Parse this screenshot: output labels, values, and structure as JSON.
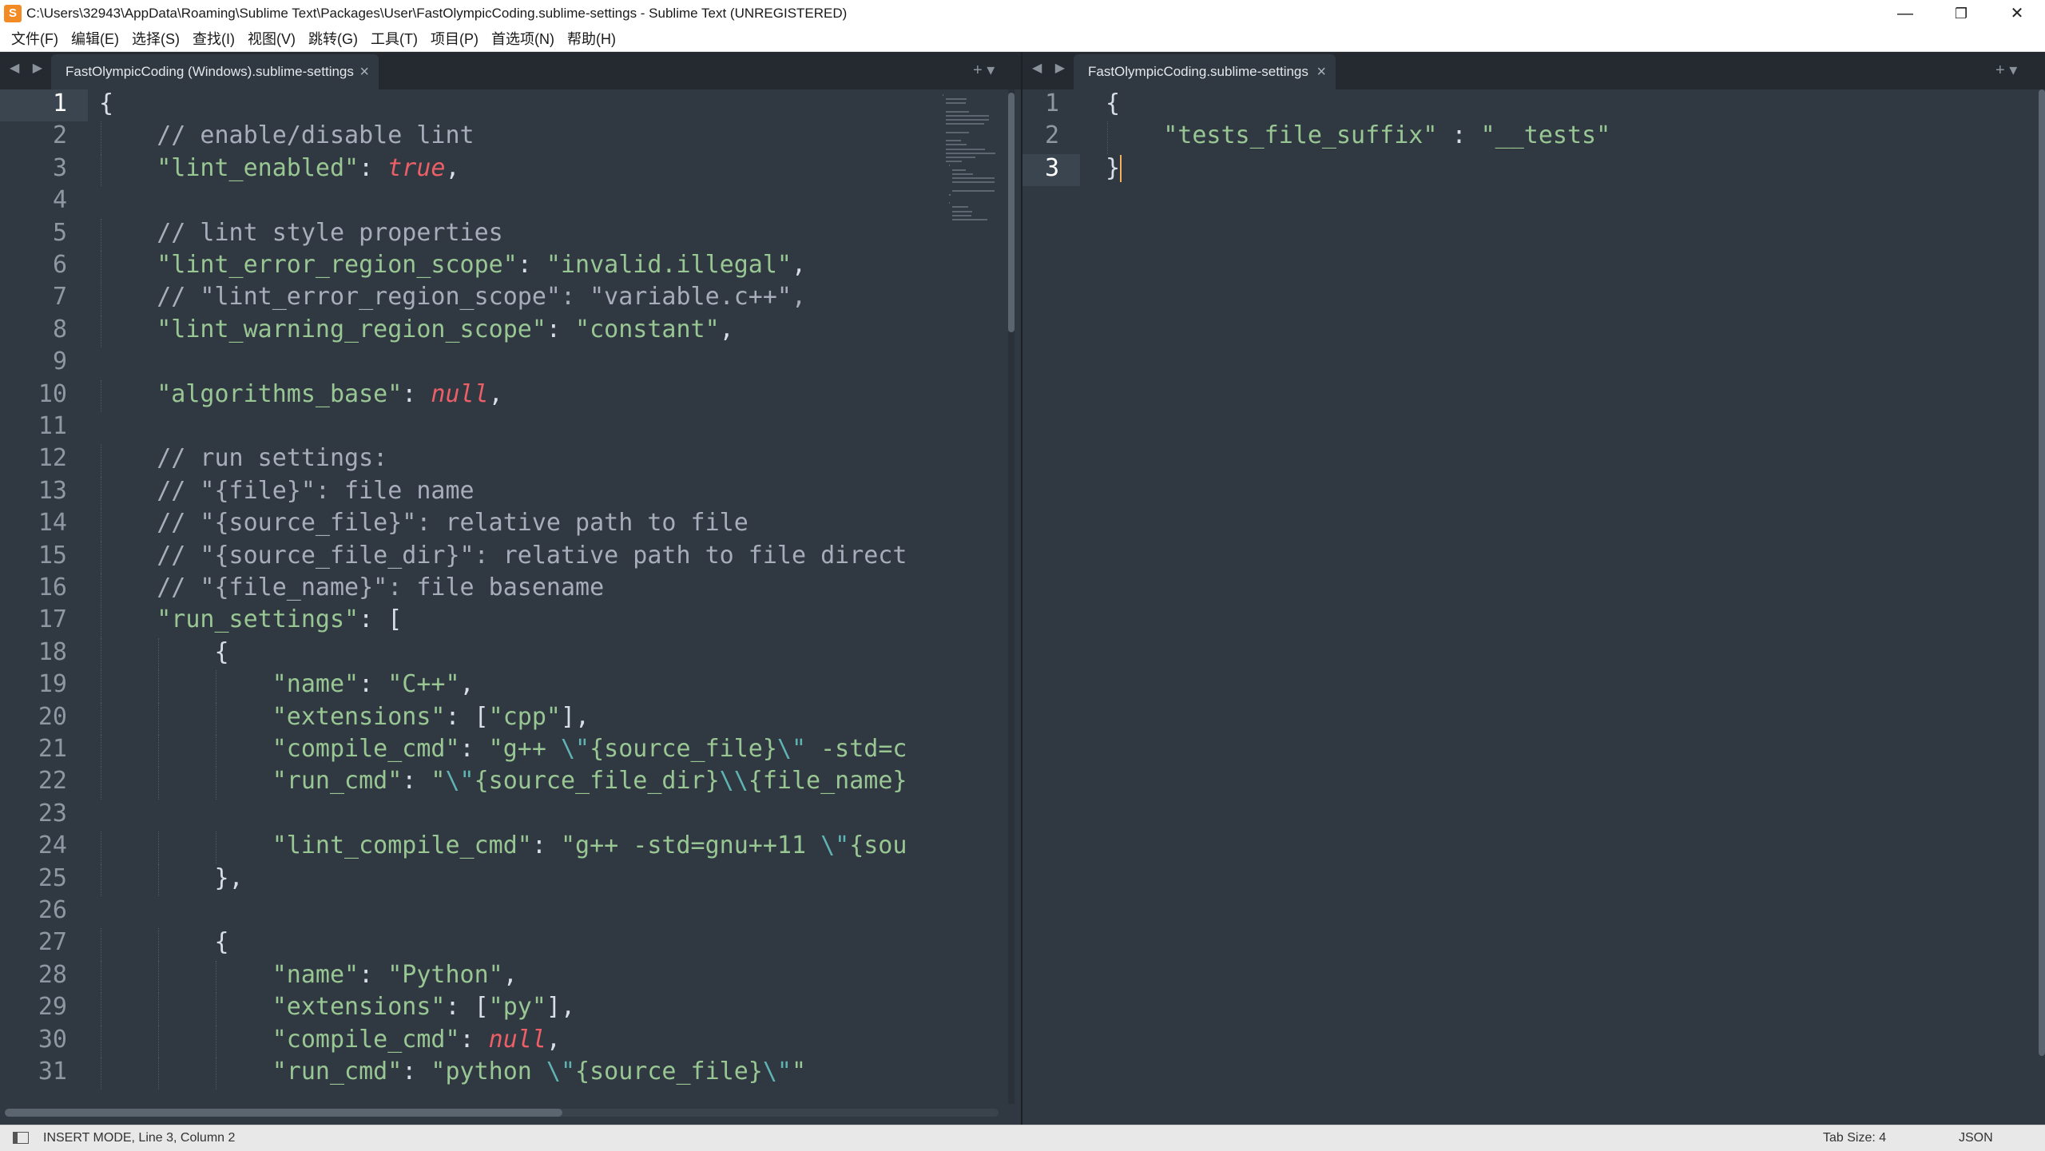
{
  "window": {
    "title": "C:\\Users\\32943\\AppData\\Roaming\\Sublime Text\\Packages\\User\\FastOlympicCoding.sublime-settings - Sublime Text (UNREGISTERED)",
    "logo_glyph": "S",
    "controls": {
      "minimize": "—",
      "restore": "❐",
      "close": "✕"
    }
  },
  "menu": [
    "文件(F)",
    "编辑(E)",
    "选择(S)",
    "查找(I)",
    "视图(V)",
    "跳转(G)",
    "工具(T)",
    "项目(P)",
    "首选项(N)",
    "帮助(H)"
  ],
  "left_pane": {
    "tab_nav": "◀ ▶",
    "tab_label": "FastOlympicCoding (Windows).sublime-settings",
    "tab_close": "×",
    "tab_tools": "+ ▾",
    "active_line": 1,
    "lines": [
      {
        "n": "1",
        "indent": 0,
        "tokens": [
          {
            "t": "{",
            "c": "punc"
          }
        ]
      },
      {
        "n": "2",
        "indent": 1,
        "tokens": [
          {
            "t": "// enable/disable lint",
            "c": "comment"
          }
        ]
      },
      {
        "n": "3",
        "indent": 1,
        "tokens": [
          {
            "t": "\"lint_enabled\"",
            "c": "str"
          },
          {
            "t": ": ",
            "c": "punc"
          },
          {
            "t": "true",
            "c": "kw"
          },
          {
            "t": ",",
            "c": "punc"
          }
        ]
      },
      {
        "n": "4",
        "indent": 0,
        "tokens": []
      },
      {
        "n": "5",
        "indent": 1,
        "tokens": [
          {
            "t": "// lint style properties",
            "c": "comment"
          }
        ]
      },
      {
        "n": "6",
        "indent": 1,
        "tokens": [
          {
            "t": "\"lint_error_region_scope\"",
            "c": "str"
          },
          {
            "t": ": ",
            "c": "punc"
          },
          {
            "t": "\"invalid.illegal\"",
            "c": "str"
          },
          {
            "t": ",",
            "c": "punc"
          }
        ]
      },
      {
        "n": "7",
        "indent": 1,
        "tokens": [
          {
            "t": "// \"lint_error_region_scope\": \"variable.c++\",",
            "c": "comment"
          }
        ]
      },
      {
        "n": "8",
        "indent": 1,
        "tokens": [
          {
            "t": "\"lint_warning_region_scope\"",
            "c": "str"
          },
          {
            "t": ": ",
            "c": "punc"
          },
          {
            "t": "\"constant\"",
            "c": "str"
          },
          {
            "t": ",",
            "c": "punc"
          }
        ]
      },
      {
        "n": "9",
        "indent": 0,
        "tokens": []
      },
      {
        "n": "10",
        "indent": 1,
        "tokens": [
          {
            "t": "\"algorithms_base\"",
            "c": "str"
          },
          {
            "t": ": ",
            "c": "punc"
          },
          {
            "t": "null",
            "c": "kw"
          },
          {
            "t": ",",
            "c": "punc"
          }
        ]
      },
      {
        "n": "11",
        "indent": 0,
        "tokens": []
      },
      {
        "n": "12",
        "indent": 1,
        "tokens": [
          {
            "t": "// run settings:",
            "c": "comment"
          }
        ]
      },
      {
        "n": "13",
        "indent": 1,
        "tokens": [
          {
            "t": "// \"{file}\": file name",
            "c": "comment"
          }
        ]
      },
      {
        "n": "14",
        "indent": 1,
        "tokens": [
          {
            "t": "// \"{source_file}\": relative path to file",
            "c": "comment"
          }
        ]
      },
      {
        "n": "15",
        "indent": 1,
        "tokens": [
          {
            "t": "// \"{source_file_dir}\": relative path to file direct",
            "c": "comment"
          }
        ]
      },
      {
        "n": "16",
        "indent": 1,
        "tokens": [
          {
            "t": "// \"{file_name}\": file basename",
            "c": "comment"
          }
        ]
      },
      {
        "n": "17",
        "indent": 1,
        "tokens": [
          {
            "t": "\"run_settings\"",
            "c": "str"
          },
          {
            "t": ": [",
            "c": "punc"
          }
        ]
      },
      {
        "n": "18",
        "indent": 2,
        "tokens": [
          {
            "t": "{",
            "c": "punc"
          }
        ]
      },
      {
        "n": "19",
        "indent": 3,
        "tokens": [
          {
            "t": "\"name\"",
            "c": "str"
          },
          {
            "t": ": ",
            "c": "punc"
          },
          {
            "t": "\"C++\"",
            "c": "str"
          },
          {
            "t": ",",
            "c": "punc"
          }
        ]
      },
      {
        "n": "20",
        "indent": 3,
        "tokens": [
          {
            "t": "\"extensions\"",
            "c": "str"
          },
          {
            "t": ": [",
            "c": "punc"
          },
          {
            "t": "\"cpp\"",
            "c": "str"
          },
          {
            "t": "],",
            "c": "punc"
          }
        ]
      },
      {
        "n": "21",
        "indent": 3,
        "tokens": [
          {
            "t": "\"compile_cmd\"",
            "c": "str"
          },
          {
            "t": ": ",
            "c": "punc"
          },
          {
            "t": "\"g++ ",
            "c": "str"
          },
          {
            "t": "\\\"",
            "c": "esc"
          },
          {
            "t": "{source_file}",
            "c": "str"
          },
          {
            "t": "\\\"",
            "c": "esc"
          },
          {
            "t": " -std=c",
            "c": "str"
          }
        ]
      },
      {
        "n": "22",
        "indent": 3,
        "tokens": [
          {
            "t": "\"run_cmd\"",
            "c": "str"
          },
          {
            "t": ": ",
            "c": "punc"
          },
          {
            "t": "\"",
            "c": "str"
          },
          {
            "t": "\\\"",
            "c": "esc"
          },
          {
            "t": "{source_file_dir}",
            "c": "str"
          },
          {
            "t": "\\\\",
            "c": "esc"
          },
          {
            "t": "{file_name}",
            "c": "str"
          }
        ]
      },
      {
        "n": "23",
        "indent": 0,
        "tokens": []
      },
      {
        "n": "24",
        "indent": 3,
        "tokens": [
          {
            "t": "\"lint_compile_cmd\"",
            "c": "str"
          },
          {
            "t": ": ",
            "c": "punc"
          },
          {
            "t": "\"g++ -std=gnu++11 ",
            "c": "str"
          },
          {
            "t": "\\\"",
            "c": "esc"
          },
          {
            "t": "{sou",
            "c": "str"
          }
        ]
      },
      {
        "n": "25",
        "indent": 2,
        "tokens": [
          {
            "t": "},",
            "c": "punc"
          }
        ]
      },
      {
        "n": "26",
        "indent": 0,
        "tokens": []
      },
      {
        "n": "27",
        "indent": 2,
        "tokens": [
          {
            "t": "{",
            "c": "punc"
          }
        ]
      },
      {
        "n": "28",
        "indent": 3,
        "tokens": [
          {
            "t": "\"name\"",
            "c": "str"
          },
          {
            "t": ": ",
            "c": "punc"
          },
          {
            "t": "\"Python\"",
            "c": "str"
          },
          {
            "t": ",",
            "c": "punc"
          }
        ]
      },
      {
        "n": "29",
        "indent": 3,
        "tokens": [
          {
            "t": "\"extensions\"",
            "c": "str"
          },
          {
            "t": ": [",
            "c": "punc"
          },
          {
            "t": "\"py\"",
            "c": "str"
          },
          {
            "t": "],",
            "c": "punc"
          }
        ]
      },
      {
        "n": "30",
        "indent": 3,
        "tokens": [
          {
            "t": "\"compile_cmd\"",
            "c": "str"
          },
          {
            "t": ": ",
            "c": "punc"
          },
          {
            "t": "null",
            "c": "kw"
          },
          {
            "t": ",",
            "c": "punc"
          }
        ]
      },
      {
        "n": "31",
        "indent": 3,
        "tokens": [
          {
            "t": "\"run_cmd\"",
            "c": "str"
          },
          {
            "t": ": ",
            "c": "punc"
          },
          {
            "t": "\"python ",
            "c": "str"
          },
          {
            "t": "\\\"",
            "c": "esc"
          },
          {
            "t": "{source_file}",
            "c": "str"
          },
          {
            "t": "\\\"",
            "c": "esc"
          },
          {
            "t": "\"",
            "c": "str"
          }
        ]
      }
    ]
  },
  "right_pane": {
    "tab_nav": "◀ ▶",
    "tab_label": "FastOlympicCoding.sublime-settings",
    "tab_close": "×",
    "tab_tools": "+ ▾",
    "active_line": 3,
    "lines": [
      {
        "n": "1",
        "indent": 0,
        "tokens": [
          {
            "t": "{",
            "c": "punc"
          }
        ]
      },
      {
        "n": "2",
        "indent": 1,
        "tokens": [
          {
            "t": "\"tests_file_suffix\"",
            "c": "str"
          },
          {
            "t": " : ",
            "c": "punc"
          },
          {
            "t": "\"__tests\"",
            "c": "str"
          }
        ]
      },
      {
        "n": "3",
        "indent": 0,
        "tokens": [
          {
            "t": "}",
            "c": "punc"
          }
        ],
        "cursor": true
      }
    ]
  },
  "status": {
    "text": "INSERT MODE, Line 3, Column 2",
    "tab_size": "Tab Size: 4",
    "syntax": "JSON"
  },
  "colors": {
    "background": "#303841",
    "comment": "#a7adba",
    "string": "#99c794",
    "keyword": "#ec5f67",
    "escape": "#5fb3b3",
    "cursor": "#f9ae58"
  }
}
